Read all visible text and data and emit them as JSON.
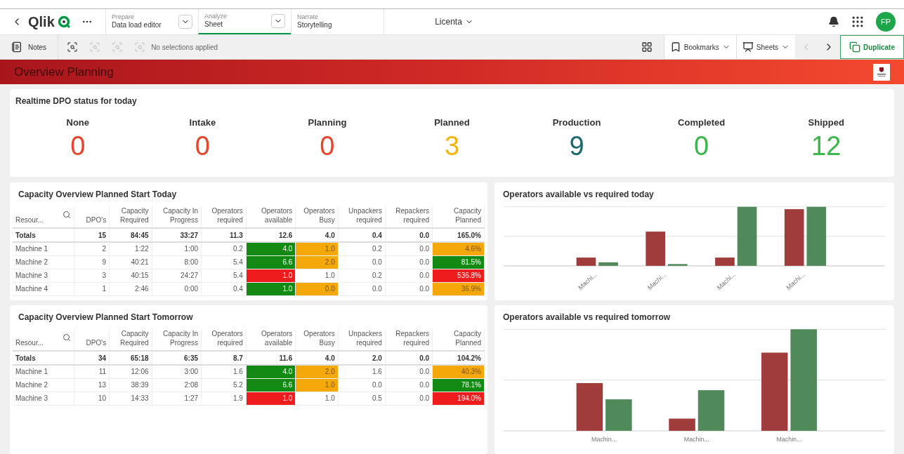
{
  "header": {
    "logo": "Qlik",
    "nav": [
      {
        "caption": "Prepare",
        "label": "Data load editor",
        "dropdown": true,
        "selected": false
      },
      {
        "caption": "Analyze",
        "label": "Sheet",
        "dropdown": true,
        "selected": true
      },
      {
        "caption": "Narrate",
        "label": "Storytelling",
        "dropdown": false,
        "selected": false
      }
    ],
    "app_name": "Licenta",
    "avatar": "FP"
  },
  "toolbar": {
    "notes": "Notes",
    "selections": "No selections applied",
    "bookmarks": "Bookmarks",
    "sheets": "Sheets",
    "duplicate": "Duplicate"
  },
  "sheet_title": "Overview Planning",
  "kpi_card": {
    "title": "Realtime DPO status for today",
    "kpis": [
      {
        "label": "None",
        "value": "0",
        "color": "#e8442c"
      },
      {
        "label": "Intake",
        "value": "0",
        "color": "#e8442c"
      },
      {
        "label": "Planning",
        "value": "0",
        "color": "#e8442c"
      },
      {
        "label": "Planned",
        "value": "3",
        "color": "#f4b400"
      },
      {
        "label": "Production",
        "value": "9",
        "color": "#1d6a6e"
      },
      {
        "label": "Completed",
        "value": "0",
        "color": "#3cb54a"
      },
      {
        "label": "Shipped",
        "value": "12",
        "color": "#3cb54a"
      }
    ]
  },
  "tables": [
    {
      "title": "Capacity Overview Planned Start Today",
      "columns": [
        "Resour...",
        "DPO's",
        "Capacity Required",
        "Capacity In Progress",
        "Operators required",
        "Operators available",
        "Operators Busy",
        "Unpackers required",
        "Repackers required",
        "Capacity Planned"
      ],
      "totals": [
        "Totals",
        "15",
        "84:45",
        "33:27",
        "11.3",
        "12.6",
        "4.0",
        "0.4",
        "0.0",
        "165.0%"
      ],
      "rows": [
        [
          {
            "text": "Machine 1"
          },
          {
            "text": "2"
          },
          {
            "text": "1:22"
          },
          {
            "text": "1:00"
          },
          {
            "text": "0.2"
          },
          {
            "text": "4.0",
            "color": "#138a13"
          },
          {
            "text": "1.0",
            "color": "#f5a80a"
          },
          {
            "text": "0.2"
          },
          {
            "text": "0.0"
          },
          {
            "text": "4.6%",
            "color": "#f5a80a"
          }
        ],
        [
          {
            "text": "Machine 2"
          },
          {
            "text": "9"
          },
          {
            "text": "40:21"
          },
          {
            "text": "8:00"
          },
          {
            "text": "5.4"
          },
          {
            "text": "6.6",
            "color": "#138a13"
          },
          {
            "text": "2.0",
            "color": "#f5a80a"
          },
          {
            "text": "0.0"
          },
          {
            "text": "0.0"
          },
          {
            "text": "81.5%",
            "color": "#138a13"
          }
        ],
        [
          {
            "text": "Machine 3"
          },
          {
            "text": "3"
          },
          {
            "text": "40:15"
          },
          {
            "text": "24:27"
          },
          {
            "text": "5.4"
          },
          {
            "text": "1.0",
            "color": "#ee1c1c"
          },
          {
            "text": "1.0"
          },
          {
            "text": "0.2"
          },
          {
            "text": "0.0"
          },
          {
            "text": "536.8%",
            "color": "#ee1c1c"
          }
        ],
        [
          {
            "text": "Machine 4"
          },
          {
            "text": "1"
          },
          {
            "text": "2:46"
          },
          {
            "text": "0:00"
          },
          {
            "text": "0.4"
          },
          {
            "text": "1.0",
            "color": "#138a13"
          },
          {
            "text": "0.0",
            "color": "#f5a80a"
          },
          {
            "text": "0.0"
          },
          {
            "text": "0.0"
          },
          {
            "text": "36.9%",
            "color": "#f5a80a"
          }
        ]
      ]
    },
    {
      "title": "Capacity Overview Planned Start Tomorrow",
      "columns": [
        "Resour...",
        "DPO's",
        "Capacity Required",
        "Capacity In Progress",
        "Operators required",
        "Operators available",
        "Operators Busy",
        "Unpackers required",
        "Repackers required",
        "Capacity Planned"
      ],
      "totals": [
        "Totals",
        "34",
        "65:18",
        "6:35",
        "8.7",
        "11.6",
        "4.0",
        "2.0",
        "0.0",
        "104.2%"
      ],
      "rows": [
        [
          {
            "text": "Machine 1"
          },
          {
            "text": "11"
          },
          {
            "text": "12:06"
          },
          {
            "text": "3:00"
          },
          {
            "text": "1.6"
          },
          {
            "text": "4.0",
            "color": "#138a13"
          },
          {
            "text": "2.0",
            "color": "#f5a80a"
          },
          {
            "text": "1.6"
          },
          {
            "text": "0.0"
          },
          {
            "text": "40.3%",
            "color": "#f5a80a"
          }
        ],
        [
          {
            "text": "Machine 2"
          },
          {
            "text": "13"
          },
          {
            "text": "38:39"
          },
          {
            "text": "2:08"
          },
          {
            "text": "5.2"
          },
          {
            "text": "6.6",
            "color": "#138a13"
          },
          {
            "text": "1.0",
            "color": "#f5a80a"
          },
          {
            "text": "0.0"
          },
          {
            "text": "0.0"
          },
          {
            "text": "78.1%",
            "color": "#138a13"
          }
        ],
        [
          {
            "text": "Machine 3"
          },
          {
            "text": "10"
          },
          {
            "text": "14:33"
          },
          {
            "text": "1:27"
          },
          {
            "text": "1.9"
          },
          {
            "text": "1.0",
            "color": "#ee1c1c"
          },
          {
            "text": "1.0"
          },
          {
            "text": "0.5"
          },
          {
            "text": "0.0"
          },
          {
            "text": "194.0%",
            "color": "#ee1c1c"
          }
        ]
      ]
    }
  ],
  "charts": [
    {
      "title": "Operators available vs required today",
      "rotated_labels": true,
      "categories": [
        "Machi...",
        "Machi...",
        "Machi...",
        "Machi..."
      ]
    },
    {
      "title": "Operators available vs required tomorrow",
      "rotated_labels": false,
      "categories": [
        "Machin...",
        "Machin...",
        "Machin..."
      ]
    }
  ]
}
